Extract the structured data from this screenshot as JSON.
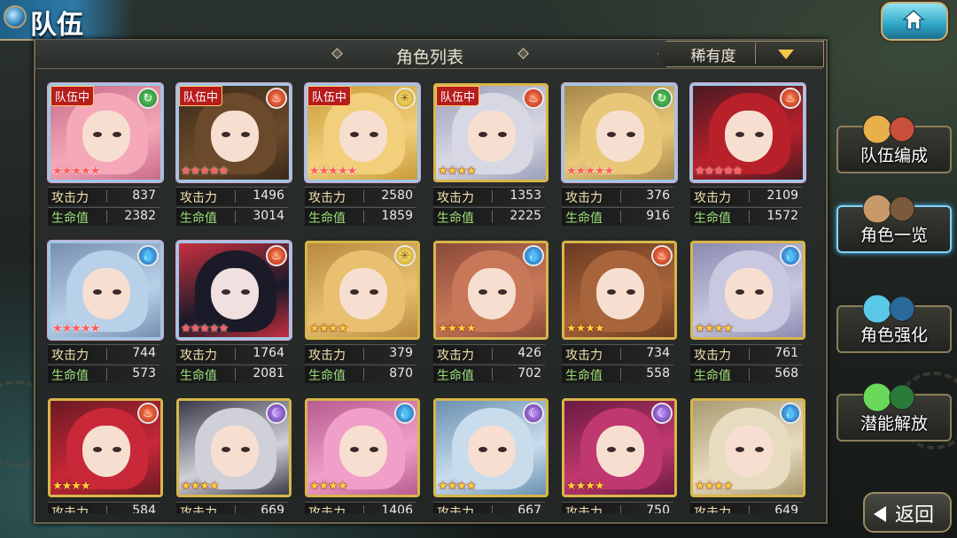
{
  "header": {
    "title": "队伍"
  },
  "panel": {
    "title": "角色列表",
    "sort": {
      "selected": "稀有度"
    }
  },
  "labels": {
    "atk": "攻击力",
    "hp": "生命值",
    "in_team": "队伍中"
  },
  "side_menu": [
    {
      "label": "队伍编成",
      "active": false
    },
    {
      "label": "角色一览",
      "active": true
    },
    {
      "label": "角色强化",
      "active": false
    },
    {
      "label": "潜能解放",
      "active": false
    }
  ],
  "back_label": "返回",
  "characters": [
    {
      "in_team": true,
      "element": "wind",
      "stars": 5,
      "atk": "837",
      "hp": "2382"
    },
    {
      "in_team": true,
      "element": "fire",
      "stars": 5,
      "atk": "1496",
      "hp": "3014"
    },
    {
      "in_team": true,
      "element": "light",
      "stars": 5,
      "atk": "2580",
      "hp": "1859"
    },
    {
      "in_team": true,
      "element": "fire",
      "stars": 4,
      "atk": "1353",
      "hp": "2225"
    },
    {
      "in_team": false,
      "element": "wind",
      "stars": 5,
      "atk": "376",
      "hp": "916"
    },
    {
      "in_team": false,
      "element": "fire",
      "stars": 5,
      "atk": "2109",
      "hp": "1572"
    },
    {
      "in_team": false,
      "element": "water",
      "stars": 5,
      "atk": "744",
      "hp": "573"
    },
    {
      "in_team": false,
      "element": "fire",
      "stars": 5,
      "atk": "1764",
      "hp": "2081"
    },
    {
      "in_team": false,
      "element": "light",
      "stars": 4,
      "atk": "379",
      "hp": "870"
    },
    {
      "in_team": false,
      "element": "water",
      "stars": 4,
      "atk": "426",
      "hp": "702"
    },
    {
      "in_team": false,
      "element": "fire",
      "stars": 4,
      "atk": "734",
      "hp": "558"
    },
    {
      "in_team": false,
      "element": "water",
      "stars": 4,
      "atk": "761",
      "hp": "568"
    },
    {
      "in_team": false,
      "element": "fire",
      "stars": 4,
      "atk": "584",
      "hp": ""
    },
    {
      "in_team": false,
      "element": "dark",
      "stars": 4,
      "atk": "669",
      "hp": ""
    },
    {
      "in_team": false,
      "element": "water",
      "stars": 4,
      "atk": "1406",
      "hp": ""
    },
    {
      "in_team": false,
      "element": "dark",
      "stars": 4,
      "atk": "667",
      "hp": ""
    },
    {
      "in_team": false,
      "element": "dark",
      "stars": 4,
      "atk": "750",
      "hp": ""
    },
    {
      "in_team": false,
      "element": "water",
      "stars": 4,
      "atk": "649",
      "hp": ""
    }
  ],
  "colors": {
    "accent_blue": "#2d7aa8",
    "gold": "#d8b64a",
    "badge_red": "#b81d1d"
  }
}
